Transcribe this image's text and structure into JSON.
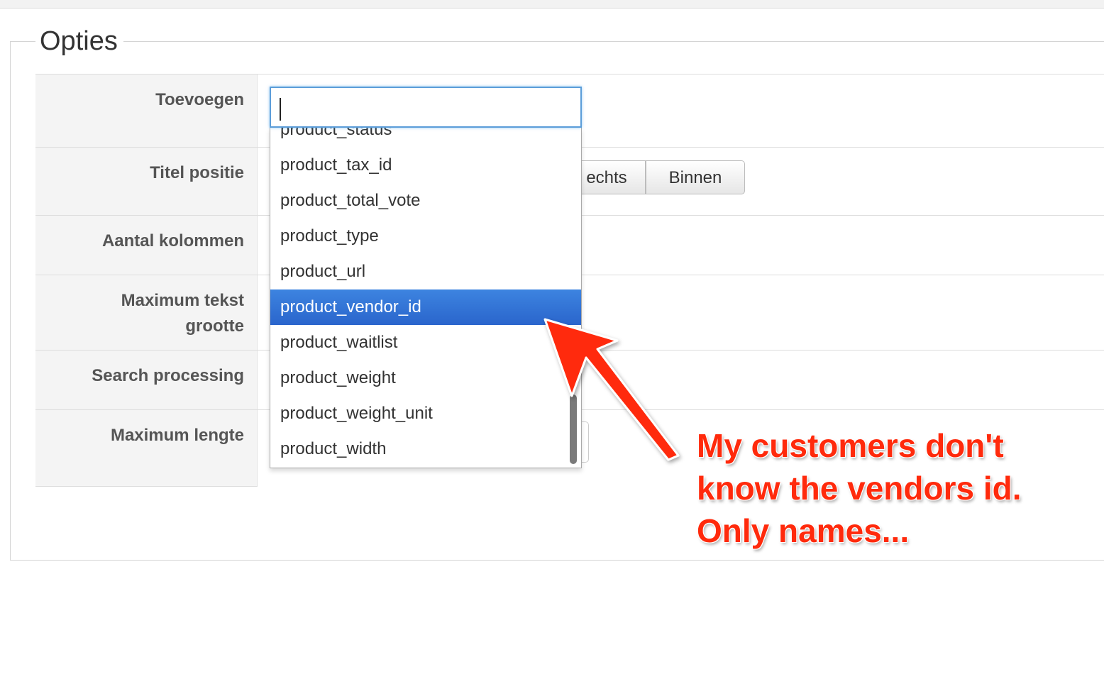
{
  "fieldset": {
    "legend": "Opties"
  },
  "form": {
    "rows": [
      {
        "label": "Toevoegen"
      },
      {
        "label": "Titel positie"
      },
      {
        "label": "Aantal kolommen"
      },
      {
        "label": "Maximum tekst grootte"
      },
      {
        "label": "Search processing"
      },
      {
        "label": "Maximum lengte"
      }
    ],
    "title_position_buttons": [
      "echts",
      "Binnen"
    ]
  },
  "dropdown": {
    "input_value": "",
    "options": [
      "product_status",
      "product_tax_id",
      "product_total_vote",
      "product_type",
      "product_url",
      "product_vendor_id",
      "product_waitlist",
      "product_weight",
      "product_weight_unit",
      "product_width"
    ],
    "selected": "product_vendor_id"
  },
  "annotation": {
    "lines": [
      "My customers don't",
      "know the vendors id.",
      "Only names..."
    ],
    "color": "#ff2a0c"
  }
}
